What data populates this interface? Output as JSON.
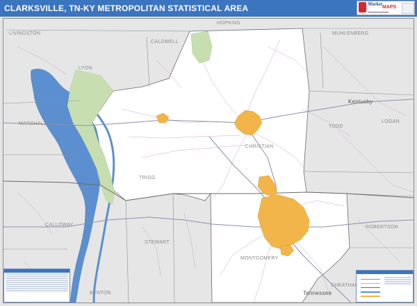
{
  "title": "CLARKSVILLE, TN-KY METROPOLITAN STATISTICAL AREA",
  "logo": {
    "name": "Market MAPS",
    "brand_color": "#d7282f",
    "accent_color": "#1c4b96"
  },
  "colors": {
    "title_bar": "#3b74bf",
    "msa_fill": "#ffffff",
    "outside_fill": "#e5e5e5",
    "water": "#5b8fd0",
    "park": "#c7dfb0",
    "urban": "#f2b54a",
    "road_highway": "#8a8fb0",
    "road_minor": "#c9a6c9"
  },
  "labels": {
    "livingston": "LIVINGSTON",
    "caldwell": "CALDWELL",
    "hopkins": "HOPKINS",
    "muhlenberg": "MUHLENBERG",
    "lyon": "LYON",
    "marshall": "MARSHALL",
    "kentucky": "Kentucky",
    "christian": "CHRISTIAN",
    "todd": "TODD",
    "logan": "LOGAN",
    "trigg": "TRIGG",
    "calloway": "CALLOWAY",
    "robertson": "ROBERTSON",
    "stewart": "STEWART",
    "montgomery": "MONTGOMERY",
    "tennessee": "Tennessee",
    "benton": "BENTON",
    "cheatham": "CHEATHAM"
  }
}
